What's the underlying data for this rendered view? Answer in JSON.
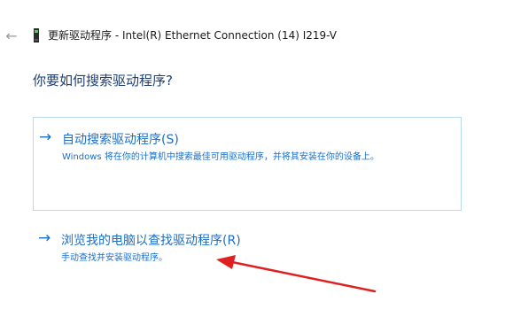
{
  "titlebar": {
    "back_icon": "back-arrow-icon",
    "device_icon": "network-adapter-icon",
    "title": "更新驱动程序 - Intel(R) Ethernet Connection (14) I219-V"
  },
  "question": "你要如何搜索驱动程序?",
  "options": [
    {
      "arrow": "→",
      "title": "自动搜索驱动程序(S)",
      "description": "Windows 将在你的计算机中搜索最佳可用驱动程序，并将其安装在你的设备上。"
    },
    {
      "arrow": "→",
      "title": "浏览我的电脑以查找驱动程序(R)",
      "description": "手动查找并安装驱动程序。"
    }
  ],
  "colors": {
    "accent": "#1a6fc9",
    "question": "#1f3f6e",
    "box_border": "#b9d9f3",
    "annotation": "#e02020"
  }
}
